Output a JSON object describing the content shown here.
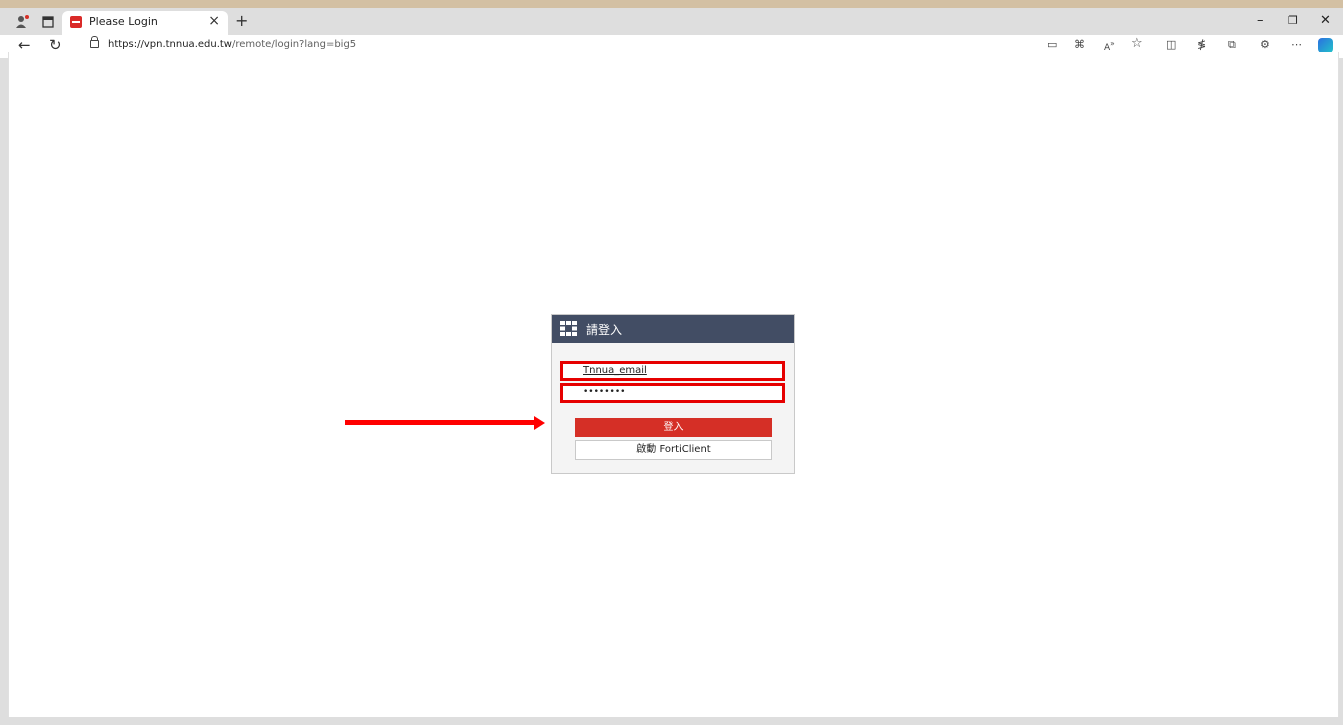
{
  "browser": {
    "tab_title": "Please Login",
    "tab_close": "×",
    "new_tab": "+",
    "url_host": "https://vpn.tnnua.edu.tw",
    "url_path": "/remote/login?lang=big5",
    "window_controls": {
      "minimize": "–",
      "restore": "❐",
      "close": "✕"
    },
    "nav": {
      "back": "←",
      "refresh": "↻"
    },
    "toolbar_icons": [
      "immersive-reader-icon",
      "apps-icon",
      "read-aloud-icon",
      "favorite-star-icon",
      "split-screen-icon",
      "favorites-icon",
      "collections-icon",
      "extensions-icon",
      "more-icon",
      "copilot-icon"
    ]
  },
  "login": {
    "title": "請登入",
    "username_value": "Tnnua_email",
    "password_value": "••••••••",
    "login_button": "登入",
    "forticlient_button": "啟動 FortiClient"
  },
  "colors": {
    "header_bg": "#424d64",
    "login_button_bg": "#d52f26",
    "highlight": "#e60000",
    "page_bg": "#d3c0a3"
  }
}
